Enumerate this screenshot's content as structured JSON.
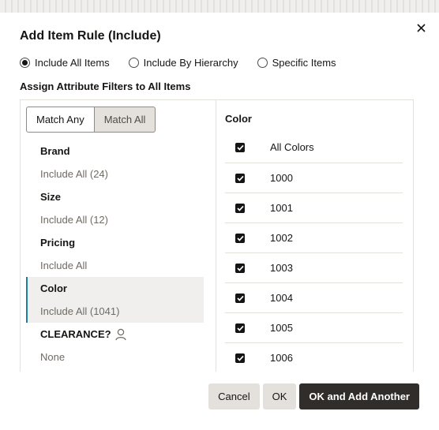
{
  "dialog": {
    "title": "Add Item Rule (Include)"
  },
  "scope_options": [
    {
      "label": "Include All Items",
      "checked": true
    },
    {
      "label": "Include By Hierarchy",
      "checked": false
    },
    {
      "label": "Specific Items",
      "checked": false
    }
  ],
  "section_label": "Assign Attribute Filters to All Items",
  "match": {
    "any_label": "Match Any",
    "all_label": "Match All",
    "selected": "Match Any"
  },
  "filters": [
    {
      "name": "Brand",
      "value": "Include All (24)"
    },
    {
      "name": "Size",
      "value": "Include All (12)"
    },
    {
      "name": "Pricing",
      "value": "Include All"
    },
    {
      "name": "Color",
      "value": "Include All (1041)"
    },
    {
      "name": "CLEARANCE?",
      "value": "None"
    }
  ],
  "selected_filter": "Color",
  "color_panel": {
    "header": "Color",
    "all_label": "All Colors",
    "values": [
      "1000",
      "1001",
      "1002",
      "1003",
      "1004",
      "1005",
      "1006"
    ]
  },
  "footer": {
    "cancel_label": "Cancel",
    "ok_label": "OK",
    "ok_add_label": "OK and Add Another"
  },
  "colors": {
    "primary_button": "#312d2a",
    "secondary_button": "#e4e1dd",
    "selected_accent": "#227e9e"
  }
}
